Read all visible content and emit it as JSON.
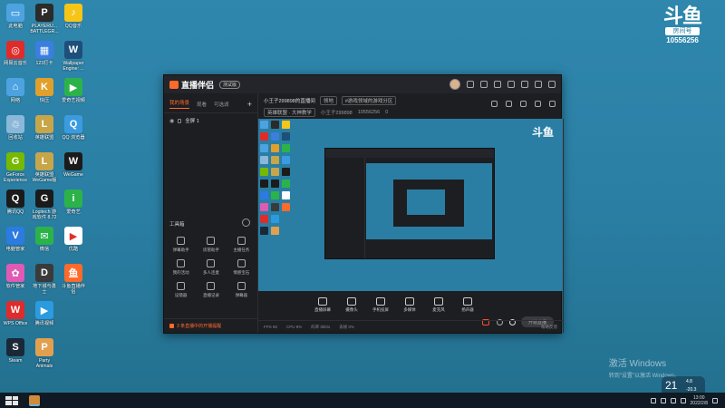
{
  "desktop": {
    "icons": [
      {
        "label": "此电脑",
        "color": "#4da3e0",
        "glyph": "▭"
      },
      {
        "label": "PLAYERU...\nBATTLEGR...",
        "color": "#2b2b2b",
        "glyph": "P"
      },
      {
        "label": "QQ音乐",
        "color": "#f5c518",
        "glyph": "♪"
      },
      {
        "label": "网易云音乐",
        "color": "#e02b2b",
        "glyph": "◎"
      },
      {
        "label": "123打卡",
        "color": "#3a7ee0",
        "glyph": "▦"
      },
      {
        "label": "Wallpaper\nEngine: ...",
        "color": "#1d4f7a",
        "glyph": "W"
      },
      {
        "label": "网络",
        "color": "#4da3e0",
        "glyph": "⌂"
      },
      {
        "label": "快压",
        "color": "#e0a02b",
        "glyph": "K"
      },
      {
        "label": "爱奇艺视频",
        "color": "#2bb34a",
        "glyph": "▶"
      },
      {
        "label": "回收站",
        "color": "#8bb8d8",
        "glyph": "♲"
      },
      {
        "label": "英雄联盟",
        "color": "#c7a64a",
        "glyph": "L"
      },
      {
        "label": "QQ 浏览器",
        "color": "#3a9be0",
        "glyph": "Q"
      },
      {
        "label": "GeForce\nExperience",
        "color": "#76b900",
        "glyph": "G"
      },
      {
        "label": "英雄联盟\nWeGame版",
        "color": "#c7a64a",
        "glyph": "L"
      },
      {
        "label": "WeGame",
        "color": "#1b1b1b",
        "glyph": "W"
      },
      {
        "label": "腾讯QQ",
        "color": "#1b1b1b",
        "glyph": "Q"
      },
      {
        "label": "Logitech 游\n戏软件 8.72",
        "color": "#1b1b1b",
        "glyph": "G"
      },
      {
        "label": "爱奇艺",
        "color": "#2bb34a",
        "glyph": "i"
      },
      {
        "label": "电脑管家",
        "color": "#2b7be0",
        "glyph": "V"
      },
      {
        "label": "微信",
        "color": "#2bb34a",
        "glyph": "✉"
      },
      {
        "label": "优酷",
        "color": "#ffffff",
        "glyph": "▶"
      },
      {
        "label": "软件管家",
        "color": "#e05ab3",
        "glyph": "✿"
      },
      {
        "label": "地下城与勇士",
        "color": "#3a3a3a",
        "glyph": "D"
      },
      {
        "label": "斗鱼直播伴侣",
        "color": "#ff6a2b",
        "glyph": "鱼"
      },
      {
        "label": "WPS Office",
        "color": "#e02b2b",
        "glyph": "W"
      },
      {
        "label": "腾讯视频",
        "color": "#2b9be0",
        "glyph": "▶"
      },
      {
        "label": "",
        "color": "transparent",
        "glyph": ""
      },
      {
        "label": "Steam",
        "color": "#1b2838",
        "glyph": "S"
      },
      {
        "label": "Party\nAnimals",
        "color": "#e0a050",
        "glyph": "P"
      }
    ],
    "douyu": {
      "mark": "斗鱼",
      "sub": "房间号",
      "room": "10556256"
    },
    "activation": {
      "title": "激活 Windows",
      "hint": "转到\"设置\"以激活 Windows。"
    },
    "weather": {
      "temp": "21",
      "hi": "4.8",
      "lo": "-20.3"
    }
  },
  "app": {
    "title": "直播伴侣",
    "beta": "测试版",
    "tabs": [
      "我的场景",
      "观看",
      "可选滤"
    ],
    "scene_name": "全屏 1",
    "room": {
      "title": "小王子299898的直播间",
      "tag": "领地",
      "category": "#游戏领域的游戏分区",
      "tag2": "英雄联盟 · 大神教学",
      "streamer": "小王子299898",
      "id": "10556256",
      "likes": "0"
    },
    "toolbox_title": "工具箱",
    "tools": [
      {
        "label": "弹幕助手"
      },
      {
        "label": "房管助手"
      },
      {
        "label": "主播任务"
      },
      {
        "label": "我的活动"
      },
      {
        "label": "多人连麦"
      },
      {
        "label": "情感宝石"
      },
      {
        "label": "设镜器"
      },
      {
        "label": "直播记录"
      },
      {
        "label": "弹幕器"
      }
    ],
    "sidebar_notice": "3 条直播中的开播提醒",
    "controls": [
      {
        "label": "直播屏幕"
      },
      {
        "label": "摄像头"
      },
      {
        "label": "手机投屏"
      },
      {
        "label": "多媒体"
      },
      {
        "label": "麦克风"
      },
      {
        "label": "扬声器"
      }
    ],
    "start_label": "开始直播",
    "status": [
      "FPS 60",
      "CPU 8%",
      "码率 0kb/s",
      "丢帧 0%"
    ],
    "status_right": "帮助反馈"
  },
  "taskbar": {
    "time": "13:00",
    "date": "2022/2/8"
  }
}
